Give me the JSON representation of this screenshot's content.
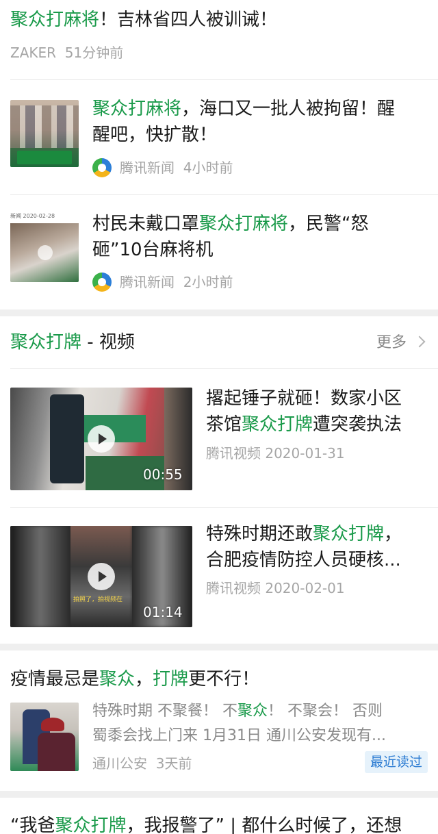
{
  "item1": {
    "title_hl": "聚众打麻将",
    "title_rest": "！吉林省四人被训诫！",
    "source": "ZAKER",
    "time": "51分钟前"
  },
  "item2": {
    "title_hl": "聚众打麻将",
    "title_rest_1": "，海口又一批人被拘留！醒",
    "title_line2": "醒吧，快扩散！",
    "source": "腾讯新闻",
    "time": "4小时前"
  },
  "item3": {
    "thumb_caption": "新闻 2020-02-28",
    "title_pre": "村民未戴口罩",
    "title_hl": "聚众打麻将",
    "title_post": "，民警“怒",
    "title_line2": "砸”10台麻将机",
    "source": "腾讯新闻",
    "time": "2小时前"
  },
  "video_section": {
    "title_hl": "聚众打牌",
    "title_rest": " - 视频",
    "more_label": "更多",
    "videos": [
      {
        "line1": "撂起锤子就砸！数家小区",
        "line2_pre": "茶馆",
        "line2_hl": "聚众打牌",
        "line2_post": "遭突袭执法",
        "meta": "腾讯视频 2020-01-31",
        "duration": "00:55"
      },
      {
        "line1_pre": "特殊时期还敢",
        "line1_hl": "聚众打牌",
        "line1_post": "，",
        "line2": "合肥疫情防控人员硬核...",
        "meta": "腾讯视频 2020-02-01",
        "duration": "01:14",
        "thumb_caption": "拍照了，拍视频在"
      }
    ]
  },
  "item4": {
    "title_pre": "疫情最忌是",
    "title_hl1": "聚众",
    "title_mid": "，",
    "title_hl2": "打牌",
    "title_post": "更不行！",
    "snippet1_pre": "特殊时期 不聚餐！ 不",
    "snippet1_hl": "聚众",
    "snippet1_post": "！ 不聚会！ 否则",
    "snippet2": "蜀黍会找上门来 1月31日 通川公安发现有...",
    "source": "通川公安",
    "time": "3天前",
    "badge": "最近读过"
  },
  "item5": {
    "title_pre": "“我爸",
    "title_hl": "聚众打牌",
    "title_post": "，我报警了” | 都什么时候了，还想"
  },
  "colors": {
    "highlight": "#1a9a4a",
    "meta": "#a5a5a5",
    "badge_bg": "#e6f2fb",
    "badge_fg": "#2b7bd2"
  }
}
